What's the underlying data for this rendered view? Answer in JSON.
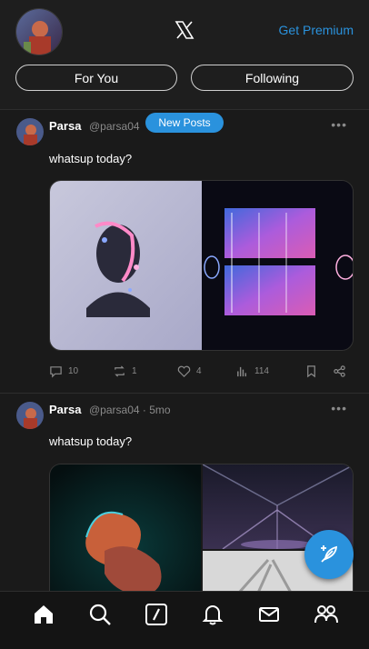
{
  "header": {
    "premium_label": "Get Premium",
    "logo_icon": "x-logo-icon",
    "tabs": [
      {
        "label": "For You"
      },
      {
        "label": "Following"
      }
    ]
  },
  "feed": {
    "new_posts_label": "New Posts",
    "posts": [
      {
        "name": "Parsa",
        "handle": "@parsa04",
        "text": "whatsup today?",
        "replies": "10",
        "reposts": "1",
        "likes": "4",
        "views": "114"
      },
      {
        "name": "Parsa",
        "handle": "@parsa04",
        "time": "· 5mo",
        "text": "whatsup today?"
      }
    ]
  },
  "nav": {
    "items": [
      "home-icon",
      "search-icon",
      "grok-icon",
      "notifications-icon",
      "messages-icon",
      "communities-icon"
    ]
  },
  "colors": {
    "accent": "#2a92dd",
    "background": "#1a1a1a"
  }
}
